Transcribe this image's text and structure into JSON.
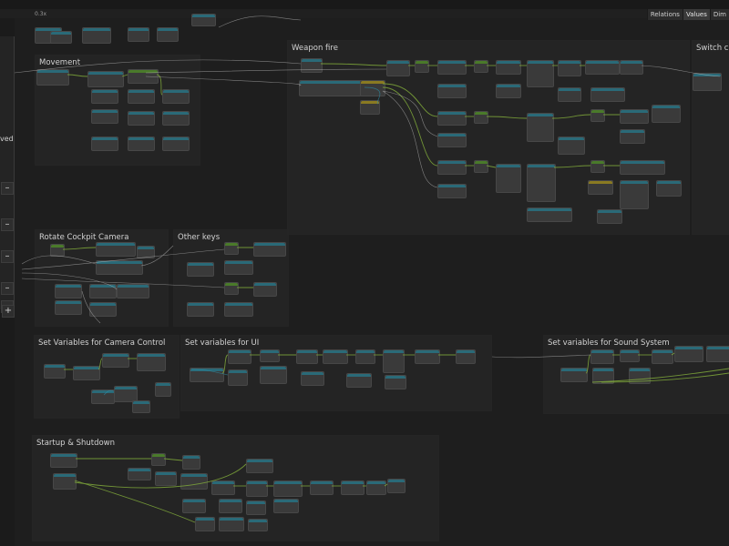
{
  "toolbar": {
    "zoom": "0.3x"
  },
  "tabs": [
    {
      "label": "Relations"
    },
    {
      "label": "Values"
    },
    {
      "label": "Dim"
    }
  ],
  "left_panel": {
    "label": "ved",
    "buttons": [
      "–",
      "–",
      "–",
      "–",
      "–",
      "+"
    ]
  },
  "groups": {
    "movement": "Movement",
    "weapon_fire": "Weapon fire",
    "switch_camera": "Switch ca",
    "rotate_cockpit_camera": "Rotate Cockpit Camera",
    "other_keys": "Other keys",
    "camera_control_vars": "Set Variables for Camera Control",
    "ui_vars": "Set variables for UI",
    "sound_vars": "Set variables for Sound System",
    "startup_shutdown": "Startup & Shutdown"
  },
  "colors": {
    "background": "#1e1e1e",
    "group_fill": "#262626",
    "node_fill": "#3a3a3a",
    "flow_wire": "#7fa83a",
    "data_wire": "#c8c8c8",
    "accent_teal": "#2a6a78"
  }
}
